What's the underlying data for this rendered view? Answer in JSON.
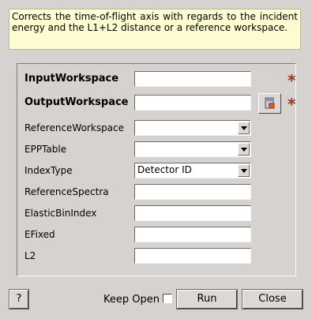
{
  "description": "Corrects the time-of-flight axis with regards to the incident energy and the L1+L2 distance or a reference workspace.",
  "fields": {
    "input_workspace": {
      "label": "InputWorkspace",
      "value": ""
    },
    "output_workspace": {
      "label": "OutputWorkspace",
      "value": ""
    },
    "reference_workspace": {
      "label": "ReferenceWorkspace",
      "value": ""
    },
    "epp_table": {
      "label": "EPPTable",
      "value": ""
    },
    "index_type": {
      "label": "IndexType",
      "value": "Detector ID"
    },
    "reference_spectra": {
      "label": "ReferenceSpectra",
      "value": ""
    },
    "elastic_bin_index": {
      "label": "ElasticBinIndex",
      "value": ""
    },
    "efixed": {
      "label": "EFixed",
      "value": ""
    },
    "l2": {
      "label": "L2",
      "value": ""
    }
  },
  "mandatory_marker": "*",
  "footer": {
    "help_label": "?",
    "keep_open_label": "Keep Open",
    "keep_open_checked": false,
    "run_label": "Run",
    "close_label": "Close"
  }
}
